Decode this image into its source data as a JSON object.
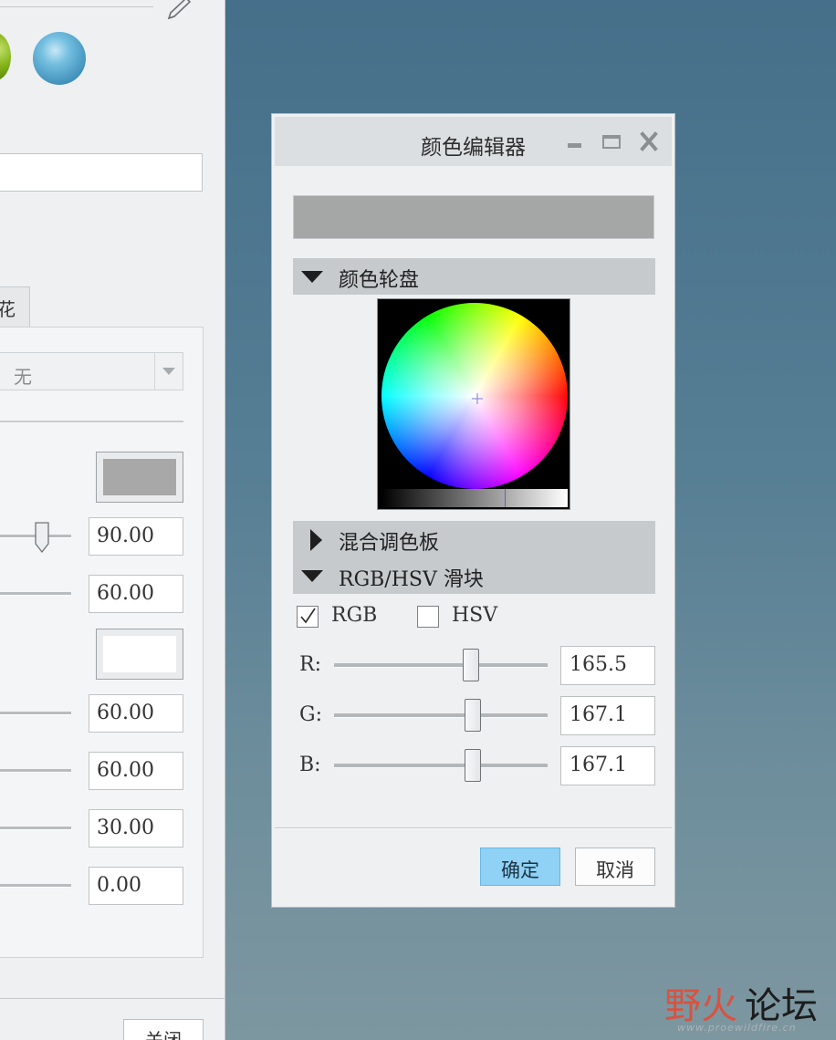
{
  "left_panel": {
    "tab_label": "花",
    "dropdown_value": "无",
    "swatch1_color": "#a8a8a8",
    "swatch2_color": "#ffffff",
    "values": [
      "90.00",
      "60.00",
      "60.00",
      "60.00",
      "30.00",
      "0.00"
    ],
    "close_label": "关闭"
  },
  "dialog": {
    "title": "颜色编辑器",
    "preview_color": "#a5a7a7",
    "sections": {
      "wheel": "颜色轮盘",
      "palette": "混合调色板",
      "sliders": "RGB/HSV 滑块"
    },
    "modes": {
      "rgb": "RGB",
      "hsv": "HSV",
      "rgb_checked": true,
      "hsv_checked": false
    },
    "channels": {
      "r_label": "R:",
      "r_value": "165.5",
      "g_label": "G:",
      "g_value": "167.1",
      "b_label": "B:",
      "b_value": "167.1"
    },
    "ok_label": "确定",
    "cancel_label": "取消"
  },
  "watermark": {
    "part1": "野火",
    "part2": "论坛",
    "url": "www.proewildfire.cn"
  }
}
